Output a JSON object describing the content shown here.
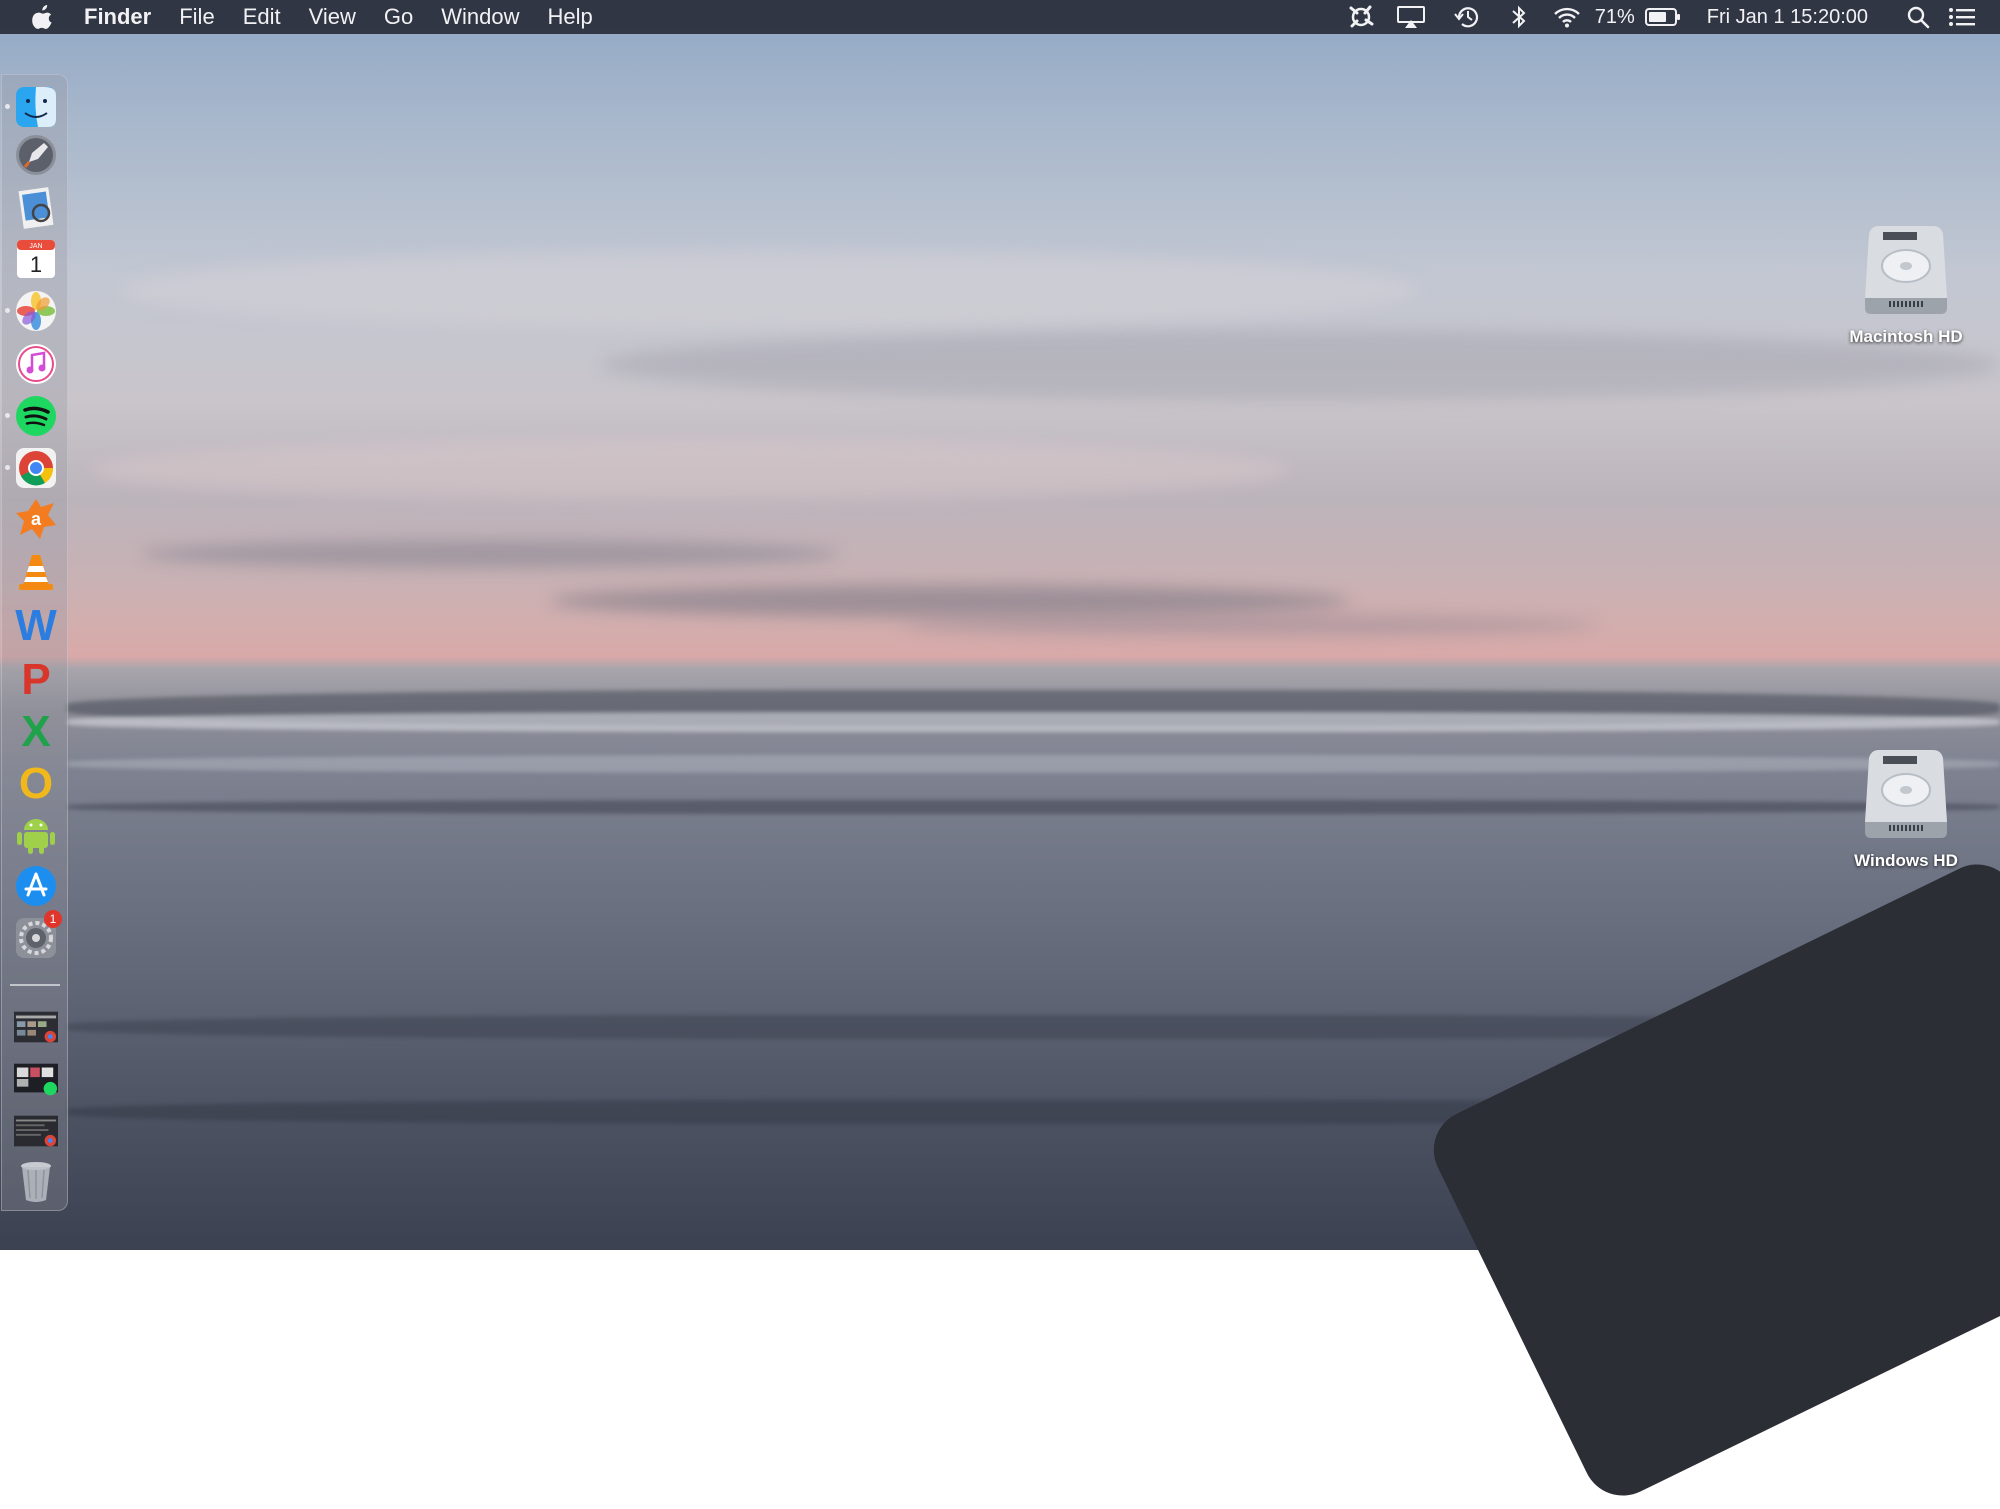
{
  "menubar": {
    "apple_icon": "apple-logo-icon",
    "app_name": "Finder",
    "menus": [
      "File",
      "Edit",
      "View",
      "Go",
      "Window",
      "Help"
    ],
    "status": {
      "battery_percent": "71%",
      "battery_level": 0.71,
      "datetime": "Fri Jan 1  15:20:00"
    }
  },
  "dock": {
    "items": [
      {
        "icon": "finder-icon",
        "running": true
      },
      {
        "icon": "launchpad-icon",
        "running": false
      },
      {
        "icon": "preview-icon",
        "running": false
      },
      {
        "icon": "calendar-icon",
        "running": false,
        "month": "JAN",
        "day": "1"
      },
      {
        "icon": "photos-icon",
        "running": true
      },
      {
        "icon": "itunes-icon",
        "running": false
      },
      {
        "icon": "spotify-icon",
        "running": true
      },
      {
        "icon": "chrome-icon",
        "running": true
      },
      {
        "icon": "avast-icon",
        "running": false,
        "letter": "a"
      },
      {
        "icon": "vlc-icon",
        "running": false
      },
      {
        "icon": "wps-writer-icon",
        "running": false,
        "letter": "W"
      },
      {
        "icon": "wps-presentation-icon",
        "running": false,
        "letter": "P"
      },
      {
        "icon": "wps-spreadsheet-icon",
        "running": false,
        "letter": "X"
      },
      {
        "icon": "wps-office-icon",
        "running": false,
        "letter": "O"
      },
      {
        "icon": "android-studio-icon",
        "running": false
      },
      {
        "icon": "app-store-icon",
        "running": false
      },
      {
        "icon": "system-preferences-icon",
        "running": false,
        "badge": "1"
      }
    ],
    "minimized": [
      {
        "icon": "minimized-chrome-window-icon"
      },
      {
        "icon": "minimized-spotify-window-icon"
      },
      {
        "icon": "minimized-chrome-window-2-icon"
      }
    ],
    "trash": {
      "icon": "trash-icon"
    }
  },
  "desktop": {
    "icons": [
      {
        "label": "Macintosh HD",
        "icon": "hard-drive-icon"
      },
      {
        "label": "Windows HD",
        "icon": "hard-drive-icon"
      }
    ]
  },
  "colors": {
    "menubar_bg": "#282c38",
    "spotify_green": "#1ed760",
    "avast_orange": "#f47c20",
    "wps_blue": "#2b7de0",
    "wps_red": "#d8362b",
    "wps_green": "#1fa24a",
    "wps_yellow": "#f0b81a",
    "android_green": "#9fd04a"
  }
}
